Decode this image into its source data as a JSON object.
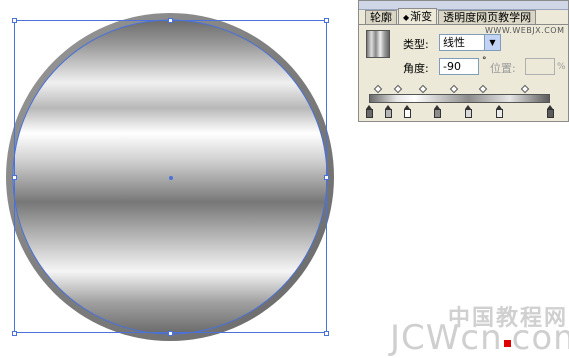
{
  "panel": {
    "tabs": [
      {
        "label": "轮廓",
        "active": false
      },
      {
        "label": "渐变",
        "active": true
      },
      {
        "label": "透明度",
        "active": false
      }
    ],
    "overlay_text": "网页教学网",
    "overlay_url": "WWW.WEBJX.COM",
    "type_label": "类型:",
    "type_value": "线性",
    "angle_label": "角度:",
    "angle_value": "-90",
    "degree_symbol": "°",
    "position_label": "位置:",
    "percent_symbol": "%",
    "gradient_stops": [
      0,
      11,
      21,
      38,
      55,
      72,
      100
    ],
    "midpoints": [
      5,
      16,
      30,
      47,
      63,
      86
    ]
  },
  "watermark": {
    "chinese": "中国教程网",
    "latin_left": "JCWcn",
    "latin_right": "com"
  },
  "colors": {
    "selection": "#4a72d8",
    "panel_bg": "#ece9d8",
    "watermark_red": "#e00000"
  }
}
